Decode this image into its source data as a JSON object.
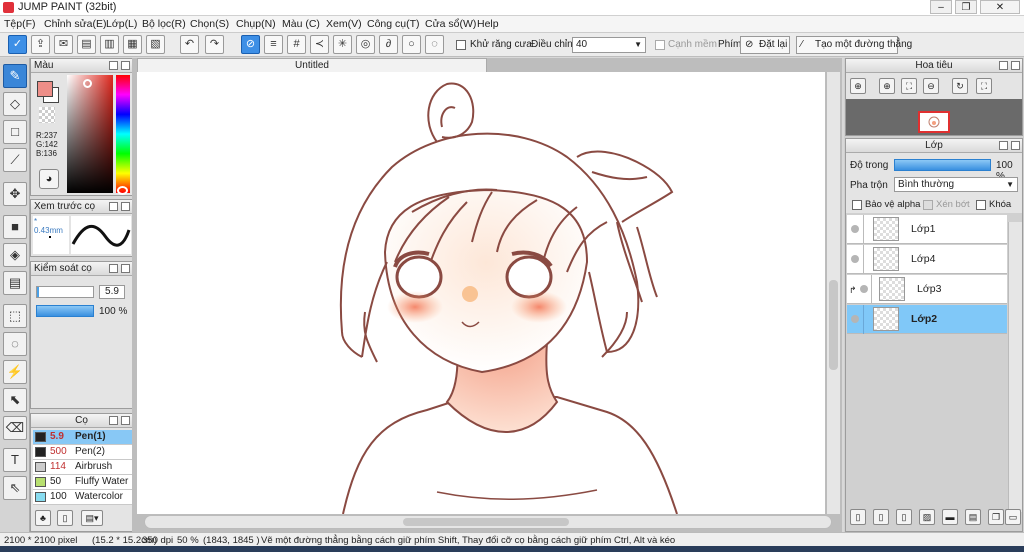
{
  "window": {
    "title": "JUMP PAINT (32bit)"
  },
  "menu": [
    "Tệp(F)",
    "Chỉnh sửa(E)",
    "Lớp(L)",
    "Bộ lọc(R)",
    "Chọn(S)",
    "Chụp(N)",
    "Màu (C)",
    "Xem(V)",
    "Công cụ(T)",
    "Cửa sổ(W)",
    "Help"
  ],
  "toolbar": {
    "antialias_label": "Khử răng cưa",
    "adjust_label": "Điều chỉnh",
    "adjust_value": "40",
    "edge_label": "Cạnh mềm",
    "key_label": "Phím",
    "reset_label": "Đặt lại",
    "make_line_label": "Tạo một đường thẳng"
  },
  "color_panel": {
    "title": "Màu",
    "r": "R:237",
    "g": "G:142",
    "b": "B:136",
    "fg_color": "#ed8e88"
  },
  "preview_panel": {
    "title": "Xem trước cọ",
    "size_label": "0.43mm"
  },
  "brush_control": {
    "title": "Kiểm soát cọ",
    "size_value": "5.9",
    "opacity_value": "100 %"
  },
  "brush_panel": {
    "title": "Cọ",
    "brushes": [
      {
        "size": "5.9",
        "name": "Pen(1)",
        "color": "#222222"
      },
      {
        "size": "500",
        "name": "Pen(2)",
        "color": "#222222"
      },
      {
        "size": "114",
        "name": "Airbrush",
        "color": "#cccccc"
      },
      {
        "size": "50",
        "name": "Fluffy Water",
        "color": "#b8e070"
      },
      {
        "size": "100",
        "name": "Watercolor",
        "color": "#88dcf0"
      }
    ]
  },
  "canvas": {
    "tab_title": "Untitled"
  },
  "navigator": {
    "title": "Hoa tiêu"
  },
  "layers": {
    "title": "Lớp",
    "opacity_label": "Độ trong",
    "opacity_value": "100 %",
    "blend_label": "Pha trộn",
    "blend_value": "Bình thường",
    "alpha_label": "Bảo vệ alpha",
    "clip_label": "Xén bớt",
    "lock_label": "Khóa",
    "items": [
      {
        "name": "Lớp1"
      },
      {
        "name": "Lớp4"
      },
      {
        "name": "Lớp3"
      },
      {
        "name": "Lớp2"
      }
    ]
  },
  "status": {
    "size": "2100 * 2100 pixel",
    "cm": "(15.2 * 15.2cm)",
    "dpi": "350 dpi",
    "zoom": "50 %",
    "coords": "(1843, 1845 )",
    "hint": "Vẽ một đường thẳng bằng cách giữ phím Shift, Thay đổi cỡ cọ bằng cách giữ phím Ctrl, Alt và kéo"
  }
}
